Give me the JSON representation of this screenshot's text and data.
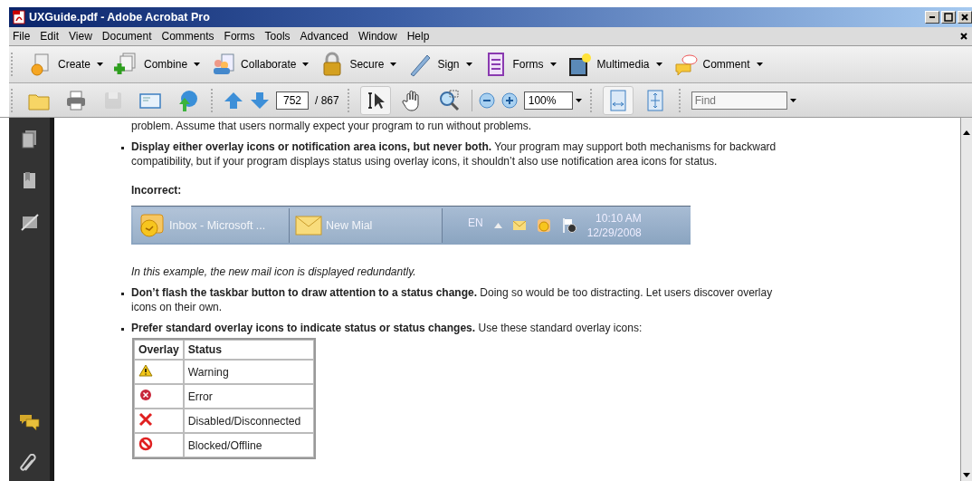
{
  "window": {
    "title": "UXGuide.pdf - Adobe Acrobat Pro"
  },
  "menu": [
    "File",
    "Edit",
    "View",
    "Document",
    "Comments",
    "Forms",
    "Tools",
    "Advanced",
    "Window",
    "Help"
  ],
  "task_toolbar": [
    {
      "kind": "create",
      "label": "Create"
    },
    {
      "kind": "combine",
      "label": "Combine"
    },
    {
      "kind": "collaborate",
      "label": "Collaborate"
    },
    {
      "kind": "secure",
      "label": "Secure"
    },
    {
      "kind": "sign",
      "label": "Sign"
    },
    {
      "kind": "forms",
      "label": "Forms"
    },
    {
      "kind": "multimedia",
      "label": "Multimedia"
    },
    {
      "kind": "comment",
      "label": "Comment"
    }
  ],
  "file_toolbar": [
    {
      "kind": "open",
      "disabled": false
    },
    {
      "kind": "print",
      "disabled": false
    },
    {
      "kind": "save",
      "disabled": true
    },
    {
      "kind": "email",
      "disabled": false
    },
    {
      "kind": "upload",
      "disabled": false
    }
  ],
  "page_nav": {
    "current_page": "752",
    "total": "/ 867"
  },
  "tools": [
    {
      "kind": "select",
      "selected": true
    },
    {
      "kind": "hand",
      "selected": false
    },
    {
      "kind": "marquee-zoom",
      "selected": false
    }
  ],
  "zoom": {
    "value": "100%"
  },
  "view_tools": [
    {
      "kind": "fit-width",
      "selected": true
    },
    {
      "kind": "fit-page",
      "selected": false
    }
  ],
  "find": {
    "placeholder": "Find"
  },
  "document": {
    "cut_line": "problem. Assume that users normally expect your program to run without problems.",
    "bullet_1": "**Display either overlay icons or notification area icons, but never both.** Your program may support both mechanisms for backward compatibility, but if your program displays status using overlay icons, it shouldn’t also use notification area icons for status.",
    "incorrect_label": "Incorrect:",
    "taskbar": {
      "buttons": [
        {
          "kind": "outlook",
          "label": "Inbox - Microsoft ..."
        },
        {
          "kind": "mail",
          "label": "New Mial"
        }
      ],
      "language": "EN",
      "time": "10:10 AM",
      "date": "12/29/2008"
    },
    "caption": "In this example, the new mail icon is displayed redundantly.",
    "bullet_2": "**Don’t flash the taskbar button to draw attention to a status change.** Doing so would be too distracting. Let users discover overlay icons on their own.",
    "bullet_3": "**Prefer standard overlay icons to indicate status or status changes.** Use these standard overlay icons:",
    "table": {
      "columns": [
        "Overlay",
        "Status"
      ],
      "rows": [
        {
          "kind": "warning",
          "status": "Warning"
        },
        {
          "kind": "error",
          "status": "Error"
        },
        {
          "kind": "disabled",
          "status": "Disabled/Disconnected"
        },
        {
          "kind": "blocked",
          "status": "Blocked/Offline"
        }
      ]
    }
  }
}
